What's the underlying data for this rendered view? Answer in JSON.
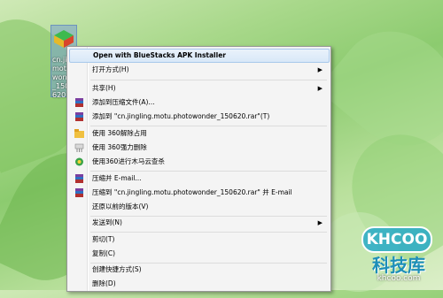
{
  "desktop": {
    "icon_label": "cn.ji\nmotu.\nwond\n_150\n620."
  },
  "menu": {
    "items": [
      {
        "label": "Open with BlueStacks APK Installer",
        "bold": true
      },
      {
        "label": "打开方式(H)",
        "submenu": true
      },
      {
        "label": "共享(H)",
        "submenu": true
      },
      {
        "label": "添加到压缩文件(A)..."
      },
      {
        "label": "添加到 \"cn.jingling.motu.photowonder_150620.rar\"(T)"
      },
      {
        "label": "使用 360解除占用"
      },
      {
        "label": "使用 360强力删除"
      },
      {
        "label": "使用360进行木马云查杀"
      },
      {
        "label": "压缩并 E-mail..."
      },
      {
        "label": "压缩到 \"cn.jingling.motu.photowonder_150620.rar\" 并 E-mail"
      },
      {
        "label": "还原以前的版本(V)"
      },
      {
        "label": "发送到(N)",
        "submenu": true
      },
      {
        "label": "剪切(T)"
      },
      {
        "label": "复制(C)"
      },
      {
        "label": "创建快捷方式(S)"
      },
      {
        "label": "删除(D)"
      }
    ]
  },
  "watermark": {
    "badge": "KHCOO",
    "name": "科技库",
    "url": "khcoo.com"
  },
  "icons": {
    "bluestacks": "bluestacks-icon",
    "archive": "winrar-archive-icon",
    "unlock": "unlock-folder-icon",
    "shred": "shred-icon",
    "scan": "360-scan-icon"
  },
  "colors": {
    "menu_bg": "#f4f4f4",
    "highlight": "#d8e8f8"
  }
}
